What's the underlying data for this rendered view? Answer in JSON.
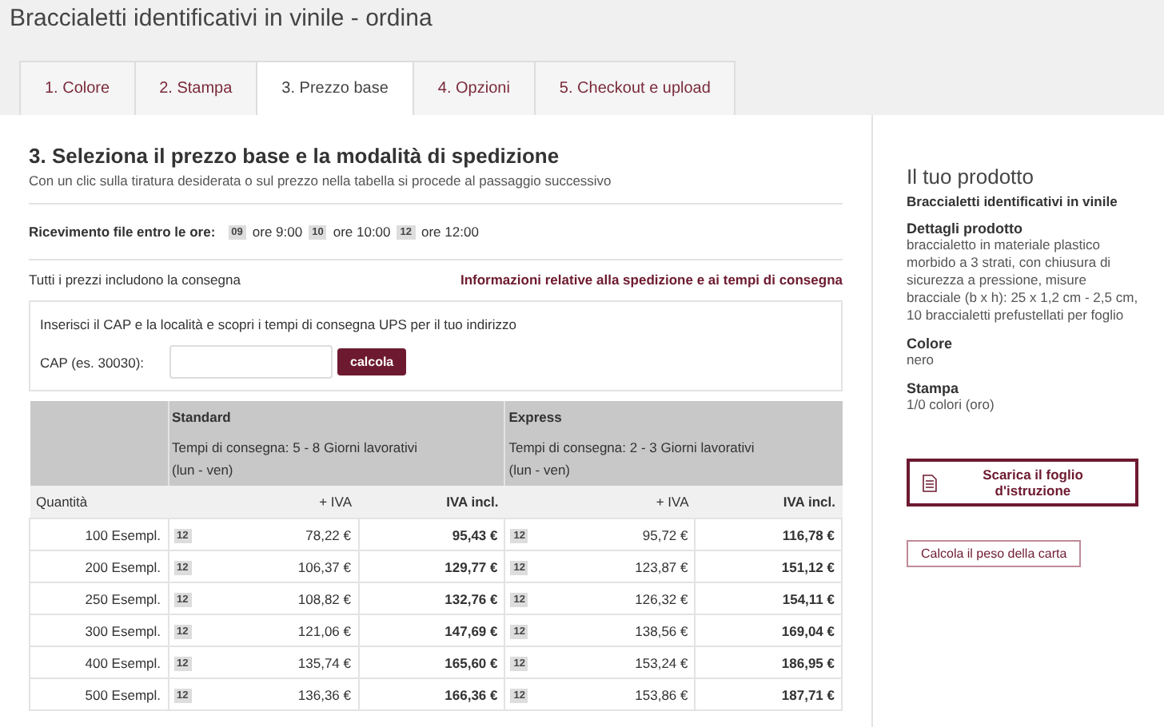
{
  "page_title": "Braccialetti identificativi in vinile - ordina",
  "tabs": [
    {
      "label": "1. Colore",
      "selected": false
    },
    {
      "label": "2. Stampa",
      "selected": false
    },
    {
      "label": "3. Prezzo base",
      "selected": true
    },
    {
      "label": "4. Opzioni",
      "selected": false
    },
    {
      "label": "5. Checkout e upload",
      "selected": false
    }
  ],
  "section": {
    "heading": "3. Seleziona il prezzo base e la modalità di spedizione",
    "subtitle": "Con un clic sulla tiratura desiderata o sul prezzo nella tabella si procede al passaggio successivo"
  },
  "deadlines": {
    "label": "Ricevimento file entro le ore:",
    "options": [
      {
        "badge": "09",
        "time": "ore 9:00"
      },
      {
        "badge": "10",
        "time": "ore 10:00"
      },
      {
        "badge": "12",
        "time": "ore 12:00"
      }
    ]
  },
  "delivery_note": "Tutti i prezzi includono la consegna",
  "shipping_link": "Informazioni relative alla spedizione e ai tempi di consegna",
  "zip_box": {
    "intro": "Inserisci il CAP e la località e scopri i tempi di consegna UPS per il tuo indirizzo",
    "label": "CAP (es. 30030):",
    "button": "calcola"
  },
  "price_table": {
    "services": [
      {
        "name": "Standard",
        "time": "Tempi di consegna: 5 - 8 Giorni lavorativi",
        "days": "(lun - ven)"
      },
      {
        "name": "Express",
        "time": "Tempi di consegna: 2 - 3 Giorni lavorativi",
        "days": "(lun - ven)"
      }
    ],
    "columns": [
      "Quantità",
      "+ IVA",
      "IVA incl.",
      "+ IVA",
      "IVA incl."
    ],
    "rows": [
      {
        "qty": "100 Esempl.",
        "prices": [
          {
            "badge": "12",
            "net": "78,22 €",
            "gross": "95,43 €"
          },
          {
            "badge": "12",
            "net": "95,72 €",
            "gross": "116,78 €"
          }
        ]
      },
      {
        "qty": "200 Esempl.",
        "prices": [
          {
            "badge": "12",
            "net": "106,37 €",
            "gross": "129,77 €"
          },
          {
            "badge": "12",
            "net": "123,87 €",
            "gross": "151,12 €"
          }
        ]
      },
      {
        "qty": "250 Esempl.",
        "prices": [
          {
            "badge": "12",
            "net": "108,82 €",
            "gross": "132,76 €"
          },
          {
            "badge": "12",
            "net": "126,32 €",
            "gross": "154,11 €"
          }
        ]
      },
      {
        "qty": "300 Esempl.",
        "prices": [
          {
            "badge": "12",
            "net": "121,06 €",
            "gross": "147,69 €"
          },
          {
            "badge": "12",
            "net": "138,56 €",
            "gross": "169,04 €"
          }
        ]
      },
      {
        "qty": "400 Esempl.",
        "prices": [
          {
            "badge": "12",
            "net": "135,74 €",
            "gross": "165,60 €"
          },
          {
            "badge": "12",
            "net": "153,24 €",
            "gross": "186,95 €"
          }
        ]
      },
      {
        "qty": "500 Esempl.",
        "prices": [
          {
            "badge": "12",
            "net": "136,36 €",
            "gross": "166,36 €"
          },
          {
            "badge": "12",
            "net": "153,86 €",
            "gross": "187,71 €"
          }
        ]
      }
    ]
  },
  "sidebar": {
    "title": "Il tuo prodotto",
    "product": "Braccialetti identificativi in vinile",
    "details": [
      {
        "label": "Dettagli prodotto",
        "value": "braccialetto in materiale plastico morbido a 3 strati, con chiusura di sicurezza a pressione, misure bracciale (b x h): 25 x 1,2 cm - 2,5 cm, 10 braccialetti prefustellati per foglio"
      },
      {
        "label": "Colore",
        "value": "nero"
      },
      {
        "label": "Stampa",
        "value": "1/0 colori (oro)"
      }
    ],
    "download_button": "Scarica il foglio d'istruzione",
    "weight_button": "Calcola il peso della carta"
  }
}
